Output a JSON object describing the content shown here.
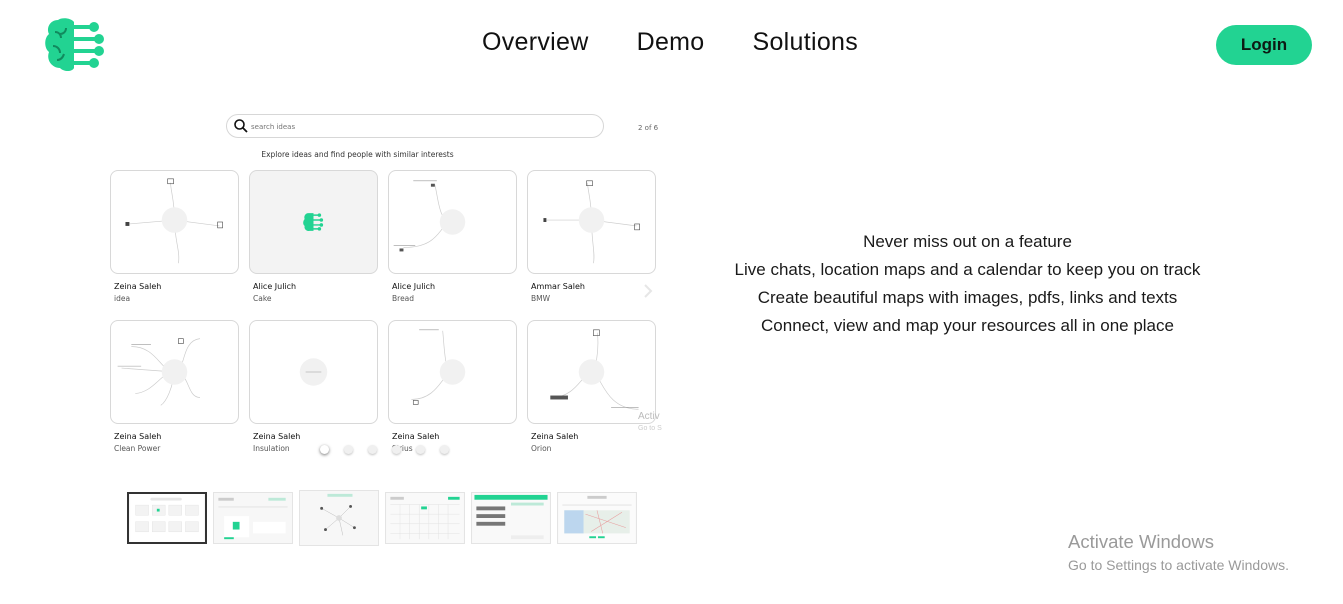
{
  "brand": {
    "logo_icon": "brain-circuit-icon",
    "accent_color": "#22d392"
  },
  "nav": {
    "items": [
      "Overview",
      "Demo",
      "Solutions"
    ]
  },
  "header": {
    "login_label": "Login"
  },
  "demo": {
    "search_placeholder": "search ideas",
    "pager": "2 of 6",
    "explore_text": "Explore ideas and find people with similar interests",
    "cards": [
      {
        "owner": "Zeina Saleh",
        "title": "idea"
      },
      {
        "owner": "Alice Julich",
        "title": "Cake"
      },
      {
        "owner": "Alice Julich",
        "title": "Bread"
      },
      {
        "owner": "Ammar Saleh",
        "title": "BMW"
      },
      {
        "owner": "Zeina Saleh",
        "title": "Clean Power"
      },
      {
        "owner": "Zeina Saleh",
        "title": "Insulation"
      },
      {
        "owner": "Zeina Saleh",
        "title": "Sirius"
      },
      {
        "owner": "Zeina Saleh",
        "title": "Orion"
      }
    ],
    "carousel_dots": 6,
    "active_dot": 0,
    "ghost_activate": "Activ",
    "ghost_goto": "Go to S"
  },
  "thumbnails": {
    "count": 6,
    "active_index": 0
  },
  "features": {
    "lines": [
      "Never miss out on a feature",
      "Live chats, location maps and a calendar to keep you on track",
      "Create beautiful maps with images, pdfs, links and texts",
      "Connect, view and map your resources all in one place"
    ]
  },
  "watermark": {
    "title": "Activate Windows",
    "subtitle": "Go to Settings to activate Windows."
  }
}
